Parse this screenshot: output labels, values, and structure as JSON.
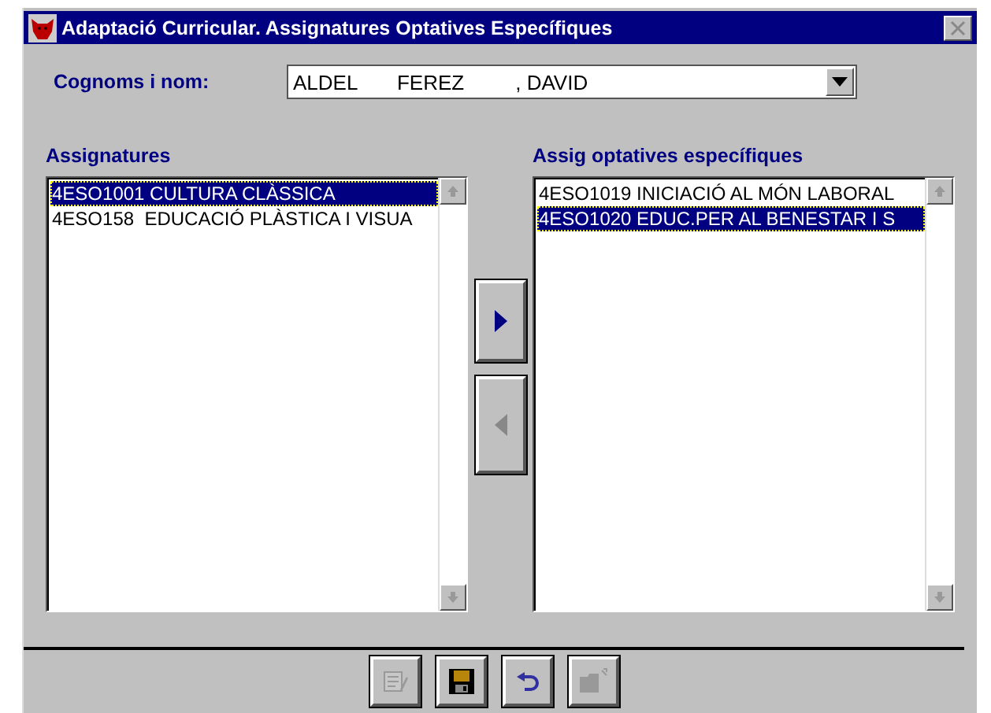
{
  "window": {
    "title": "Adaptació Curricular. Assignatures Optatives Específiques"
  },
  "name_field": {
    "label": "Cognoms i nom:",
    "value": "ALDEL       FEREZ         , DAVID"
  },
  "available": {
    "label": "Assignatures",
    "items": [
      {
        "text": "4ESO1001 CULTURA CLÀSSICA",
        "selected": true
      },
      {
        "text": "4ESO158  EDUCACIÓ PLÀSTICA I VISUA",
        "selected": false
      }
    ]
  },
  "chosen": {
    "label": "Assig optatives específiques",
    "items": [
      {
        "text": "4ESO1019 INICIACIÓ AL MÓN LABORAL",
        "selected": false
      },
      {
        "text": "4ESO1020 EDUC.PER AL BENESTAR I S",
        "selected": true
      }
    ]
  },
  "move_buttons": [
    {
      "kind": "add",
      "disabled": false
    },
    {
      "kind": "remove",
      "disabled": true
    }
  ],
  "toolbar": [
    {
      "kind": "edit",
      "disabled": true
    },
    {
      "kind": "save",
      "disabled": false
    },
    {
      "kind": "undo",
      "disabled": false
    },
    {
      "kind": "open",
      "disabled": true
    }
  ]
}
